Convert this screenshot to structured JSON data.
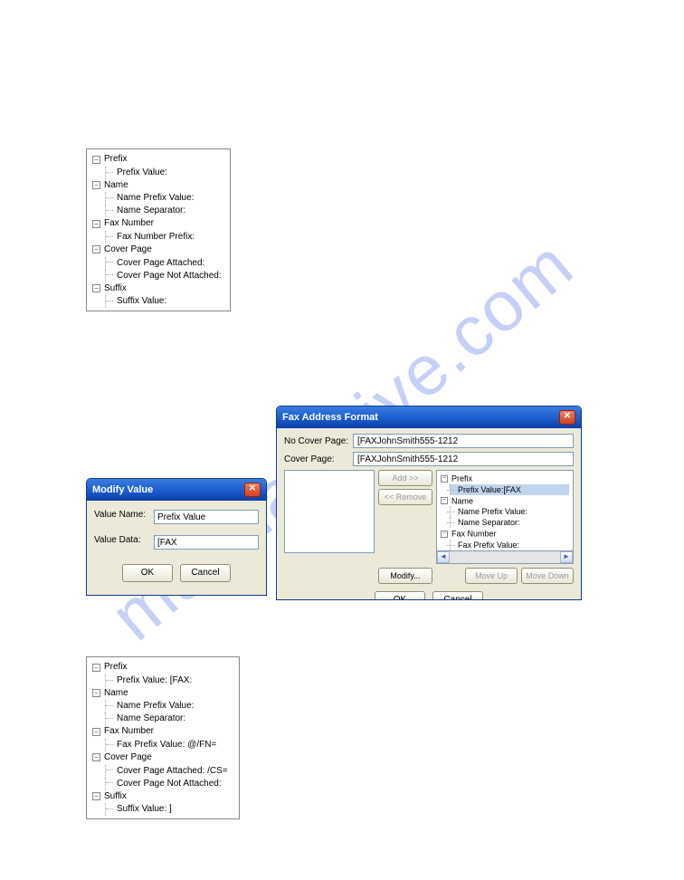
{
  "watermark": "manualshive.com",
  "tree1": {
    "nodes": [
      {
        "label": "Prefix",
        "children": [
          "Prefix Value:"
        ]
      },
      {
        "label": "Name",
        "children": [
          "Name Prefix Value:",
          "Name Separator:"
        ]
      },
      {
        "label": "Fax Number",
        "children": [
          "Fax Number Prefix:"
        ]
      },
      {
        "label": "Cover Page",
        "children": [
          "Cover Page Attached:",
          "Cover Page Not Attached:"
        ]
      },
      {
        "label": "Suffix",
        "children": [
          "Suffix Value:"
        ]
      }
    ]
  },
  "tree2": {
    "nodes": [
      {
        "label": "Prefix",
        "children": [
          "Prefix Value:  [FAX:"
        ]
      },
      {
        "label": "Name",
        "children": [
          "Name Prefix Value:",
          "Name Separator:"
        ]
      },
      {
        "label": "Fax Number",
        "children": [
          "Fax Prefix Value:  @/FN="
        ]
      },
      {
        "label": "Cover Page",
        "children": [
          "Cover Page Attached:  /CS=",
          "Cover Page Not Attached:"
        ]
      },
      {
        "label": "Suffix",
        "children": [
          "Suffix Value:  ]"
        ]
      }
    ]
  },
  "modify": {
    "title": "Modify Value",
    "name_label": "Value Name:",
    "name_value": "Prefix Value",
    "data_label": "Value Data:",
    "data_value": "[FAX",
    "ok": "OK",
    "cancel": "Cancel"
  },
  "fax": {
    "title": "Fax Address Format",
    "nocover_label": "No Cover Page:",
    "nocover_value": "[FAXJohnSmith555-1212",
    "cover_label": "Cover Page:",
    "cover_value": "[FAXJohnSmith555-1212",
    "add": "Add >>",
    "remove": "<< Remove",
    "modify": "Modify...",
    "moveup": "Move Up",
    "movedown": "Move Down",
    "ok": "OK",
    "cancel": "Cancel",
    "tree": {
      "nodes": [
        {
          "label": "Prefix",
          "children": [
            "Prefix Value:[FAX"
          ]
        },
        {
          "label": "Name",
          "children": [
            "Name Prefix Value:",
            "Name Separator:"
          ]
        },
        {
          "label": "Fax Number",
          "children": [
            "Fax Prefix Value:"
          ]
        }
      ]
    }
  }
}
